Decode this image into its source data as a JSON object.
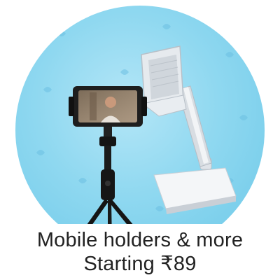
{
  "promo": {
    "title": "Mobile holders & more",
    "subtitle": "Starting ₹89"
  },
  "colors": {
    "background_circle": "#8fd8f0",
    "leaf_pattern": "#6fc3e3",
    "text": "#222222",
    "tripod": "#1b1b1b",
    "stand": "#e9ecef"
  },
  "icons": [
    "leaf-pattern-icon"
  ]
}
